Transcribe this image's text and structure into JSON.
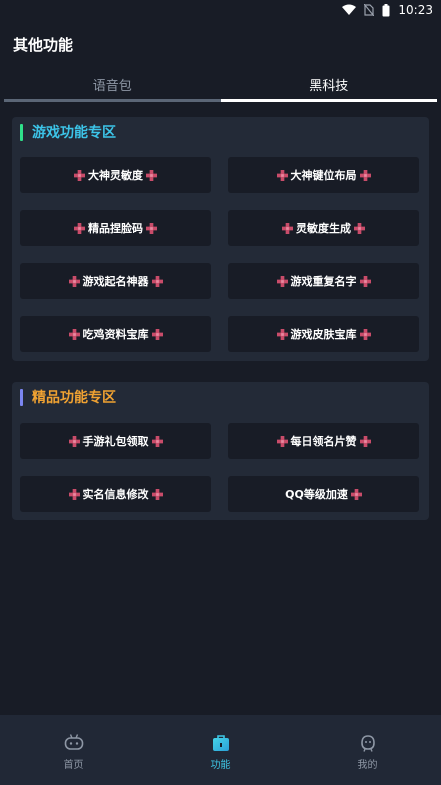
{
  "status_bar": {
    "time": "10:23"
  },
  "title": "其他功能",
  "tabs": [
    {
      "label": "语音包",
      "active": false
    },
    {
      "label": "黑科技",
      "active": true
    }
  ],
  "sections": [
    {
      "title": "游戏功能专区",
      "accent_color": "#2fe08a",
      "title_color": "#3cc4e8",
      "items": [
        "大神灵敏度",
        "大神键位布局",
        "精品捏脸码",
        "灵敏度生成",
        "游戏起名神器",
        "游戏重复名字",
        "吃鸡资料宝库",
        "游戏皮肤宝库"
      ]
    },
    {
      "title": "精品功能专区",
      "accent_color": "#7b86f2",
      "title_color": "#f0a232",
      "items": [
        "手游礼包领取",
        "每日领名片赞",
        "实名信息修改",
        "QQ等级加速"
      ]
    }
  ],
  "bottom_nav": [
    {
      "label": "首页",
      "icon": "gamepad-icon",
      "active": false
    },
    {
      "label": "功能",
      "icon": "bag-icon",
      "active": true
    },
    {
      "label": "我的",
      "icon": "profile-icon",
      "active": false
    }
  ],
  "colors": {
    "background": "#181c26",
    "card": "#232a37",
    "gem": "#c94c6a",
    "nav_active": "#3ec7e6"
  }
}
